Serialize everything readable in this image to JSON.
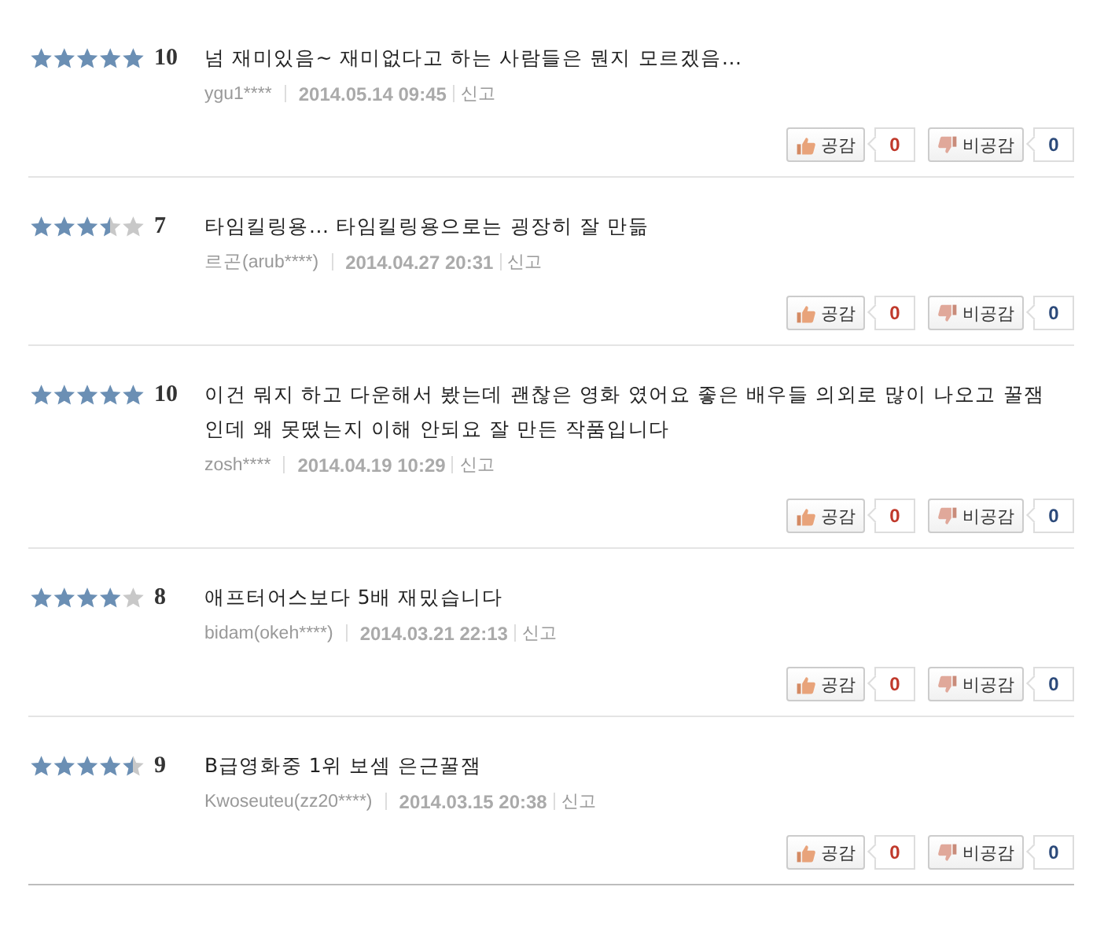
{
  "reviews": [
    {
      "stars": 5,
      "score": "10",
      "comment": "넘 재미있음~ 재미없다고 하는 사람들은 뭔지 모르겠음...",
      "author": "ygu1****",
      "date": "2014.05.14 09:45",
      "report": "신고",
      "like_label": "공감",
      "like_count": "0",
      "dislike_label": "비공감",
      "dislike_count": "0"
    },
    {
      "stars": 3.5,
      "score": "7",
      "comment": "타임킬링용... 타임킬링용으로는 굉장히 잘 만듦",
      "author": "르곤(arub****)",
      "date": "2014.04.27 20:31",
      "report": "신고",
      "like_label": "공감",
      "like_count": "0",
      "dislike_label": "비공감",
      "dislike_count": "0"
    },
    {
      "stars": 5,
      "score": "10",
      "comment": "이건 뭐지 하고 다운해서 봤는데 괜찮은 영화 였어요 좋은 배우들 의외로 많이 나오고 꿀잼인데 왜 못떴는지 이해 안되요 잘 만든 작품입니다",
      "author": "zosh****",
      "date": "2014.04.19 10:29",
      "report": "신고",
      "like_label": "공감",
      "like_count": "0",
      "dislike_label": "비공감",
      "dislike_count": "0"
    },
    {
      "stars": 4,
      "score": "8",
      "comment": "애프터어스보다 5배 재밌습니다",
      "author": "bidam(okeh****)",
      "date": "2014.03.21 22:13",
      "report": "신고",
      "like_label": "공감",
      "like_count": "0",
      "dislike_label": "비공감",
      "dislike_count": "0"
    },
    {
      "stars": 4.5,
      "score": "9",
      "comment": "B급영화중 1위 보셈 은근꿀잼",
      "author": "Kwoseuteu(zz20****)",
      "date": "2014.03.15 20:38",
      "report": "신고",
      "like_label": "공감",
      "like_count": "0",
      "dislike_label": "비공감",
      "dislike_count": "0"
    }
  ]
}
